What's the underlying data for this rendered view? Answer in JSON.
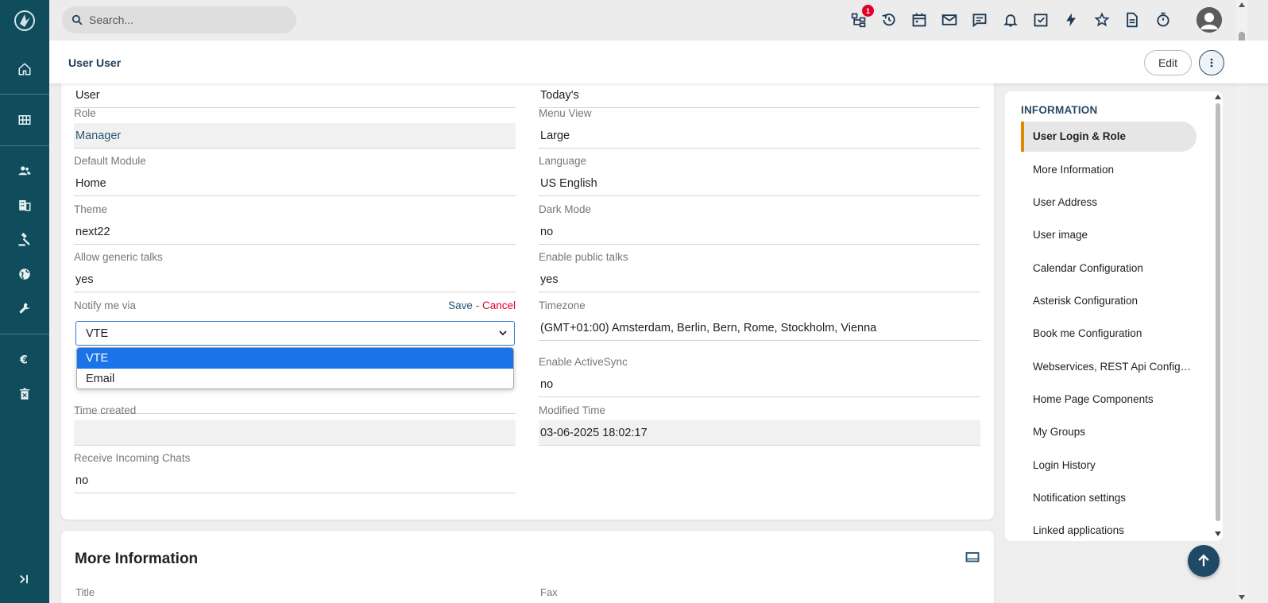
{
  "search": {
    "placeholder": "Search..."
  },
  "topbar": {
    "notification_count": "1"
  },
  "header": {
    "breadcrumb": "User User",
    "edit_label": "Edit"
  },
  "fields_left": [
    {
      "label": "",
      "value": "User"
    },
    {
      "label": "Role",
      "value": "Manager"
    },
    {
      "label": "Default Module",
      "value": "Home"
    },
    {
      "label": "Theme",
      "value": "next22"
    },
    {
      "label": "Allow generic talks",
      "value": "yes"
    },
    {
      "label": "Notify me via",
      "value": "VTE"
    },
    {
      "label": "",
      "value": ""
    },
    {
      "label": "Time created",
      "value": ""
    },
    {
      "label": "Receive Incoming Chats",
      "value": "no"
    }
  ],
  "fields_right": [
    {
      "label": "",
      "value": "Today's"
    },
    {
      "label": "Menu View",
      "value": "Large"
    },
    {
      "label": "Language",
      "value": "US English"
    },
    {
      "label": "Dark Mode",
      "value": "no"
    },
    {
      "label": "Enable public talks",
      "value": "yes"
    },
    {
      "label": "Timezone",
      "value": "(GMT+01:00) Amsterdam, Berlin, Bern, Rome, Stockholm, Vienna"
    },
    {
      "label": "Enable ActiveSync",
      "value": "no"
    },
    {
      "label": "Modified Time",
      "value": "03-06-2025 18:02:17"
    }
  ],
  "notify_edit": {
    "save": "Save",
    "separator": "-",
    "cancel": "Cancel"
  },
  "notify_options": [
    "VTE",
    "Email"
  ],
  "more_info": {
    "title": "More Information",
    "left_label": "Title",
    "right_label": "Fax"
  },
  "right_panel": {
    "title": "INFORMATION",
    "items": [
      "User Login & Role",
      "More Information",
      "User Address",
      "User image",
      "Calendar Configuration",
      "Asterisk Configuration",
      "Book me Configuration",
      "Webservices, REST Api Configuration",
      "Home Page Components",
      "My Groups",
      "Login History",
      "Notification settings",
      "Linked applications"
    ],
    "active_index": 0
  },
  "colors": {
    "rail": "#0f4c5c",
    "accent": "#e08a00",
    "link": "#2a5574",
    "cancel": "#e0002a",
    "selected_option": "#1a73e8"
  }
}
